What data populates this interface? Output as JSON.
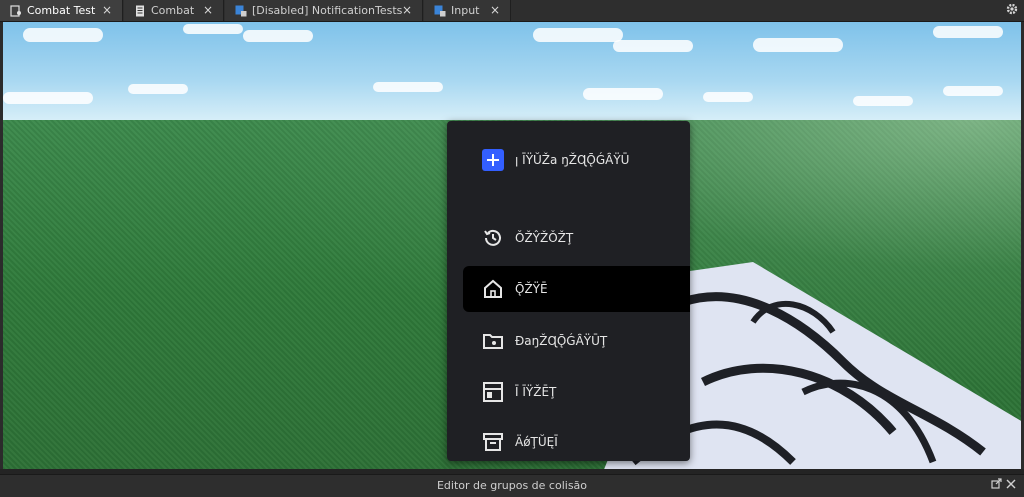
{
  "tabs": [
    {
      "label": "Combat Test",
      "icon": "script-person-icon",
      "active": true
    },
    {
      "label": "Combat",
      "icon": "script-icon",
      "active": false
    },
    {
      "label": "[Disabled] NotificationTests",
      "icon": "module-script-icon",
      "active": false
    },
    {
      "label": "Input",
      "icon": "module-script-icon",
      "active": false
    }
  ],
  "tab_close": "×",
  "menu": {
    "items": [
      {
        "label": "ꞁ ĪŸŬŽa ŋŽɊǬǴȂŸŪ",
        "icon": "plus-icon"
      },
      {
        "label": "ǑŽŶŽǑŽŢ",
        "icon": "history-icon"
      },
      {
        "label": "ǬŽŸĒ",
        "icon": "home-icon"
      },
      {
        "label": "ƉaŋŽɊǬǴȂŸŪŢ",
        "icon": "folder-icon"
      },
      {
        "label": "Ī ĪŸŽĒŢ",
        "icon": "layout-icon"
      },
      {
        "label": "ÄǿŢŬĘĪ",
        "icon": "archive-icon"
      }
    ]
  },
  "bottom_panel": {
    "title": "Editor de grupos de colisão"
  },
  "colors": {
    "accent": "#335fff",
    "menu_bg": "#1f2024",
    "active_item_bg": "#000000"
  }
}
